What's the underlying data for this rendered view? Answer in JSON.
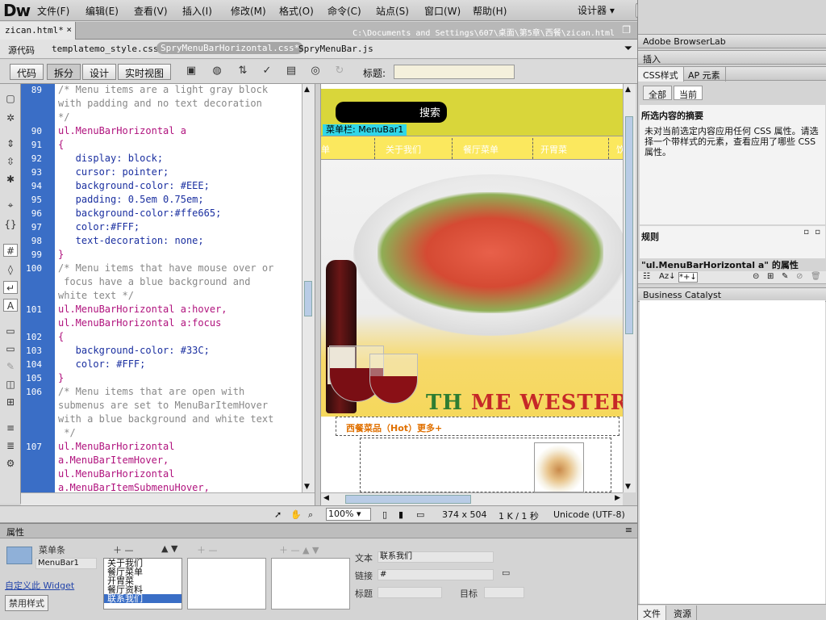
{
  "app": {
    "logo": "Dw",
    "menus": [
      "文件(F)",
      "编辑(E)",
      "查看(V)",
      "插入(I)",
      "修改(M)",
      "格式(O)",
      "命令(C)",
      "站点(S)",
      "窗口(W)",
      "帮助(H)"
    ],
    "workspace": "设计器 ▾",
    "window_controls": [
      "—",
      "❐",
      "✕"
    ]
  },
  "document": {
    "tab": "zican.html*",
    "tab_close": "×",
    "path": "C:\\Documents and Settings\\607\\桌面\\第5章\\西餐\\zican.html",
    "related": [
      "源代码",
      "templatemo_style.css",
      "SpryMenuBarHorizontal.css*",
      "SpryMenuBar.js"
    ],
    "views": [
      "代码",
      "拆分",
      "设计",
      "实时视图"
    ],
    "title_label": "标题:",
    "title_value": ""
  },
  "code": {
    "lines": [
      {
        "n": "89",
        "t": "/* Menu items are a light gray block",
        "c": "com"
      },
      {
        "n": "",
        "t": "with padding and no text decoration",
        "c": "com"
      },
      {
        "n": "",
        "t": "*/",
        "c": "com"
      },
      {
        "n": "90",
        "t": "ul.MenuBarHorizontal a",
        "c": "sel"
      },
      {
        "n": "91",
        "t": "{",
        "c": "pun"
      },
      {
        "n": "92",
        "t": "   display: block;",
        "c": "prop"
      },
      {
        "n": "93",
        "t": "   cursor: pointer;",
        "c": "prop"
      },
      {
        "n": "94",
        "t": "   background-color: #EEE;",
        "c": "prop"
      },
      {
        "n": "95",
        "t": "   padding: 0.5em 0.75em;",
        "c": "prop"
      },
      {
        "n": "96",
        "t": "   background-color:#ffe665;",
        "c": "prop"
      },
      {
        "n": "97",
        "t": "   color:#FFF;",
        "c": "prop"
      },
      {
        "n": "98",
        "t": "   text-decoration: none;",
        "c": "prop"
      },
      {
        "n": "99",
        "t": "}",
        "c": "pun"
      },
      {
        "n": "100",
        "t": "/* Menu items that have mouse over or",
        "c": "com"
      },
      {
        "n": "",
        "t": " focus have a blue background and",
        "c": "com"
      },
      {
        "n": "",
        "t": "white text */",
        "c": "com"
      },
      {
        "n": "101",
        "t": "ul.MenuBarHorizontal a:hover,",
        "c": "sel"
      },
      {
        "n": "",
        "t": "ul.MenuBarHorizontal a:focus",
        "c": "sel"
      },
      {
        "n": "102",
        "t": "{",
        "c": "pun"
      },
      {
        "n": "103",
        "t": "   background-color: #33C;",
        "c": "prop"
      },
      {
        "n": "104",
        "t": "   color: #FFF;",
        "c": "prop"
      },
      {
        "n": "105",
        "t": "}",
        "c": "pun"
      },
      {
        "n": "106",
        "t": "/* Menu items that are open with",
        "c": "com"
      },
      {
        "n": "",
        "t": "submenus are set to MenuBarItemHover",
        "c": "com"
      },
      {
        "n": "",
        "t": "with a blue background and white text",
        "c": "com"
      },
      {
        "n": "",
        "t": " */",
        "c": "com"
      },
      {
        "n": "107",
        "t": "ul.MenuBarHorizontal",
        "c": "sel"
      },
      {
        "n": "",
        "t": "a.MenuBarItemHover,",
        "c": "sel"
      },
      {
        "n": "",
        "t": "ul.MenuBarHorizontal",
        "c": "sel"
      },
      {
        "n": "",
        "t": "a.MenuBarItemSubmenuHover,",
        "c": "sel"
      }
    ]
  },
  "design": {
    "search_button": "搜索",
    "menubar_label": "菜单栏: MenuBar1",
    "nav": [
      "单",
      "关于我们",
      "餐厅菜单",
      "开胃菜",
      "饮"
    ],
    "brand_green": "TH",
    "brand_red": "ME WESTERN",
    "hot_label": "西餐菜品（Hot）更多+"
  },
  "status": {
    "zoom": "100%",
    "size": "374 x 504",
    "file_info": "1 K / 1 秒",
    "encoding": "Unicode (UTF-8)"
  },
  "properties": {
    "title": "属性",
    "element_type": "菜单条",
    "element_id": "MenuBar1",
    "custom_link": "自定义此 Widget",
    "disable_style": "禁用样式",
    "items": [
      "关于我们",
      "餐厅菜单",
      "开胃菜",
      "餐厅资料",
      "联系我们"
    ],
    "text_label": "文本",
    "text_value": "联系我们",
    "link_label": "链接",
    "link_value": "#",
    "title_label": "标题",
    "target_label": "目标"
  },
  "panels": {
    "browserlab": "Adobe BrowserLab",
    "insert": "插入",
    "css_tabs": [
      "CSS样式",
      "AP 元素"
    ],
    "mode_buttons": [
      "全部",
      "当前"
    ],
    "summary_title": "所选内容的摘要",
    "summary_text": "未对当前选定内容应用任何 CSS 属性。请选择一个带样式的元素，查看应用了哪些 CSS 属性。",
    "rules": "规则",
    "attr_title": "\"ul.MenuBarHorizontal a\" 的属性",
    "business": "Business Catalyst",
    "bottom_tabs": [
      "文件",
      "资源"
    ]
  },
  "colors": {
    "gutter": "#3a6ec6",
    "header_yellow": "#d9d63a",
    "nav_yellow": "#fbe85e",
    "menubar_cyan": "#30d7e8",
    "hot_orange": "#e07000"
  }
}
